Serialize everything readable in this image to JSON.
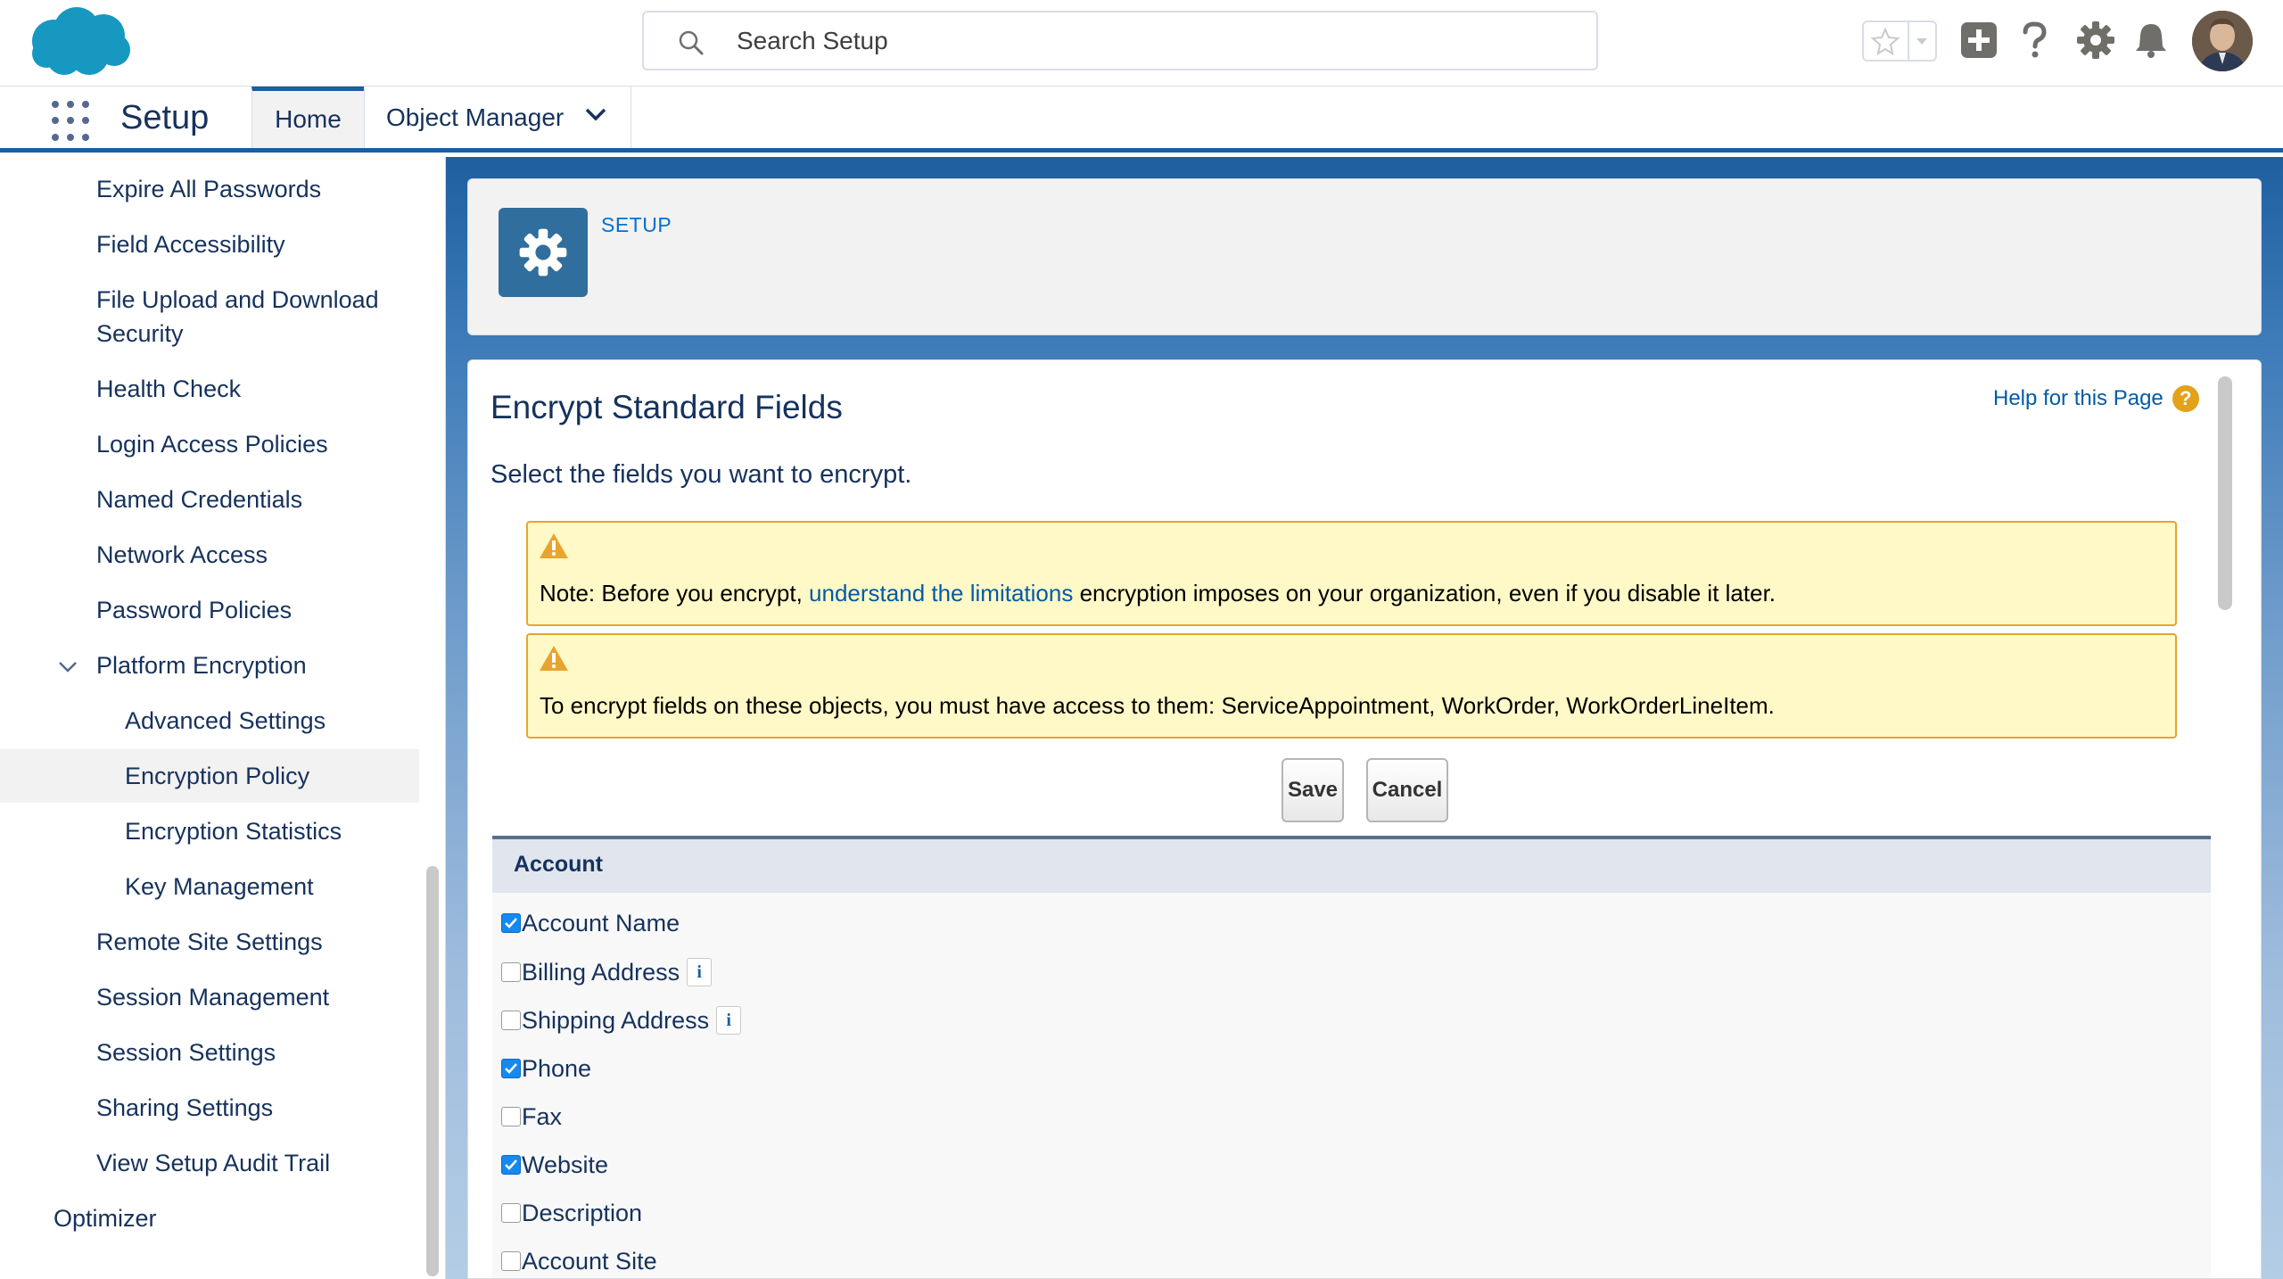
{
  "header": {
    "search_placeholder": "Search Setup"
  },
  "context": {
    "app_name": "Setup",
    "tabs": [
      {
        "label": "Home"
      },
      {
        "label": "Object Manager"
      }
    ]
  },
  "sidebar": {
    "items": [
      {
        "label": "Expire All Passwords"
      },
      {
        "label": "Field Accessibility"
      },
      {
        "label": "File Upload and Download"
      },
      {
        "label": "Security"
      },
      {
        "label": "Health Check"
      },
      {
        "label": "Login Access Policies"
      },
      {
        "label": "Named Credentials"
      },
      {
        "label": "Network Access"
      },
      {
        "label": "Password Policies"
      },
      {
        "label": "Platform Encryption"
      },
      {
        "label": "Advanced Settings"
      },
      {
        "label": "Encryption Policy"
      },
      {
        "label": "Encryption Statistics"
      },
      {
        "label": "Key Management"
      },
      {
        "label": "Remote Site Settings"
      },
      {
        "label": "Session Management"
      },
      {
        "label": "Session Settings"
      },
      {
        "label": "Sharing Settings"
      },
      {
        "label": "View Setup Audit Trail"
      },
      {
        "label": "Optimizer"
      }
    ],
    "selected": "Encryption Policy"
  },
  "main": {
    "breadcrumb": "SETUP",
    "title": "Encrypt Standard Fields",
    "help_link": "Help for this Page",
    "help_icon": "?",
    "subtitle": "Select the fields you want to encrypt.",
    "warnings": [
      {
        "before": "Note: Before you encrypt, ",
        "link": "understand the limitations",
        "after": " encryption imposes on your organization, even if you disable it later."
      },
      {
        "text": "To encrypt fields on these objects, you must have access to them: ServiceAppointment, WorkOrder, WorkOrderLineItem."
      }
    ],
    "buttons": {
      "save": "Save",
      "cancel": "Cancel"
    },
    "section": {
      "title": "Account",
      "fields": [
        {
          "label": "Account Name",
          "checked": true,
          "info": false
        },
        {
          "label": "Billing Address",
          "checked": false,
          "info": true
        },
        {
          "label": "Shipping Address",
          "checked": false,
          "info": true
        },
        {
          "label": "Phone",
          "checked": true,
          "info": false
        },
        {
          "label": "Fax",
          "checked": false,
          "info": false
        },
        {
          "label": "Website",
          "checked": true,
          "info": false
        },
        {
          "label": "Description",
          "checked": false,
          "info": false
        },
        {
          "label": "Account Site",
          "checked": false,
          "info": false
        }
      ],
      "info_glyph": "i"
    }
  },
  "colors": {
    "brand_blue": "#1b5f9e",
    "link_blue": "#015ba7",
    "warning_bg": "#fff8c7",
    "warning_border": "#e8a42e",
    "checkbox_checked": "#1589ee"
  }
}
